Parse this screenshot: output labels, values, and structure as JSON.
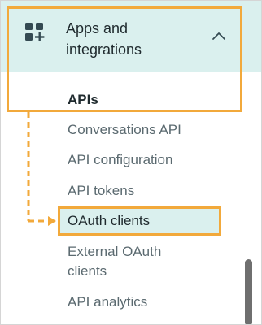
{
  "section": {
    "title": "Apps and integrations",
    "icon": "apps-add-icon",
    "toggle_icon": "chevron-up-icon"
  },
  "nav": {
    "items": [
      {
        "label": "APIs"
      },
      {
        "label": "Conversations API"
      },
      {
        "label": "API configuration"
      },
      {
        "label": "API tokens"
      },
      {
        "label": "OAuth clients"
      },
      {
        "label": "External OAuth clients"
      },
      {
        "label": "API analytics"
      }
    ]
  },
  "colors": {
    "highlight": "#f2a93b",
    "selected_bg": "#daf0ee",
    "text_primary": "#1f2a2e",
    "text_secondary": "#5b6a70"
  }
}
